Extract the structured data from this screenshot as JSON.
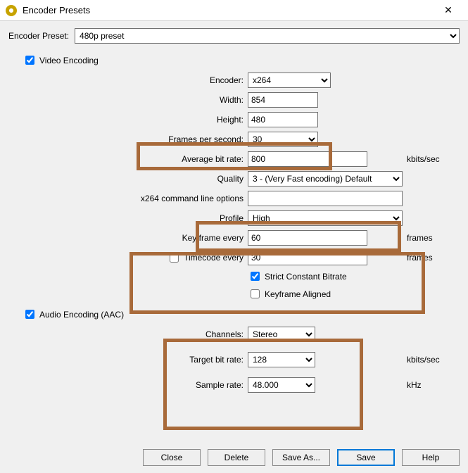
{
  "window": {
    "title": "Encoder Presets",
    "close_glyph": "✕"
  },
  "preset": {
    "label": "Encoder Preset:",
    "value": "480p preset"
  },
  "video": {
    "section_label": "Video Encoding",
    "checked": true,
    "encoder": {
      "label": "Encoder:",
      "value": "x264"
    },
    "width": {
      "label": "Width:",
      "value": "854"
    },
    "height": {
      "label": "Height:",
      "value": "480"
    },
    "fps": {
      "label": "Frames per second:",
      "value": "30"
    },
    "avg_bitrate": {
      "label": "Average bit rate:",
      "value": "800",
      "unit": "kbits/sec"
    },
    "quality": {
      "label": "Quality",
      "value": "3 - (Very Fast encoding) Default"
    },
    "x264_opts": {
      "label": "x264 command line options",
      "value": ""
    },
    "profile": {
      "label": "Profile",
      "value": "High"
    },
    "keyframe": {
      "label": "Key frame every",
      "value": "60",
      "unit": "frames"
    },
    "timecode": {
      "label": "Timecode every",
      "checked": false,
      "value": "30",
      "unit": "frames"
    },
    "strict_cbr": {
      "label": "Strict Constant Bitrate",
      "checked": true
    },
    "kf_aligned": {
      "label": "Keyframe Aligned",
      "checked": false
    }
  },
  "audio": {
    "section_label": "Audio Encoding (AAC)",
    "checked": true,
    "channels": {
      "label": "Channels:",
      "value": "Stereo"
    },
    "bitrate": {
      "label": "Target bit rate:",
      "value": "128",
      "unit": "kbits/sec"
    },
    "samplerate": {
      "label": "Sample rate:",
      "value": "48.000",
      "unit": "kHz"
    }
  },
  "buttons": {
    "close": "Close",
    "delete": "Delete",
    "save_as": "Save As...",
    "save": "Save",
    "help": "Help"
  }
}
